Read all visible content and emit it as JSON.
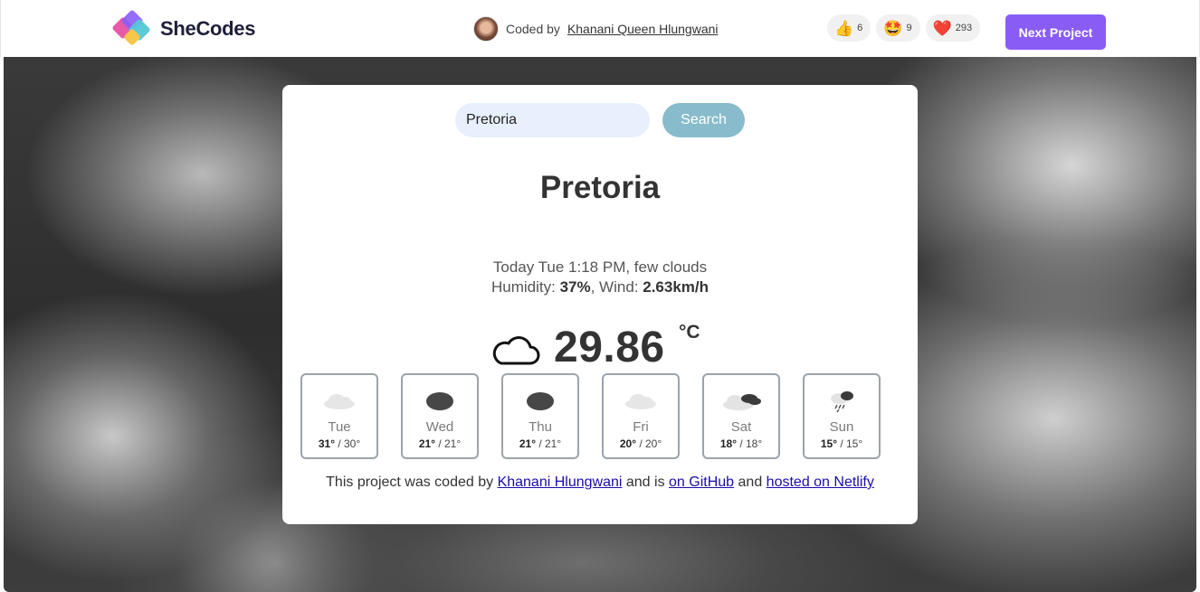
{
  "header": {
    "logo_text": "SheCodes",
    "coded_by_prefix": "Coded by",
    "author_name": "Khanani Queen Hlungwani",
    "reactions": [
      {
        "icon": "thumbs-up-icon",
        "emoji": "👍",
        "count": "6"
      },
      {
        "icon": "star-eyes-icon",
        "emoji": "🤩",
        "count": "9"
      },
      {
        "icon": "heart-icon",
        "emoji": "❤️",
        "count": "293"
      }
    ],
    "next_button": "Next Project",
    "accent_color": "#8a5cf6"
  },
  "search": {
    "value": "Pretoria",
    "button_label": "Search"
  },
  "weather": {
    "city": "Pretoria",
    "date_line_prefix": "Today Tue 1:18 PM, few clouds",
    "humidity_label": "Humidity: ",
    "humidity_value": "37%",
    "wind_label": ", Wind: ",
    "wind_value": "2.63km/h",
    "temperature": "29.86",
    "unit": "°C",
    "icon": "cloud-icon"
  },
  "forecast": [
    {
      "day": "Tue",
      "high": "31°",
      "low": " / 30°",
      "icon": "light-cloud-icon"
    },
    {
      "day": "Wed",
      "high": "21°",
      "low": " / 21°",
      "icon": "dark-cloud-icon"
    },
    {
      "day": "Thu",
      "high": "21°",
      "low": " / 21°",
      "icon": "dark-cloud-icon"
    },
    {
      "day": "Fri",
      "high": "20°",
      "low": " / 20°",
      "icon": "light-cloud-icon"
    },
    {
      "day": "Sat",
      "high": "18°",
      "low": " / 18°",
      "icon": "broken-clouds-icon"
    },
    {
      "day": "Sun",
      "high": "15°",
      "low": " / 15°",
      "icon": "rain-cloud-icon"
    }
  ],
  "footer": {
    "text_1": "This project was coded by ",
    "link_author": "Khanani Hlungwani",
    "text_2": " and is ",
    "link_github": "on GitHub",
    "text_3": " and ",
    "link_netlify": "hosted on Netlify"
  }
}
